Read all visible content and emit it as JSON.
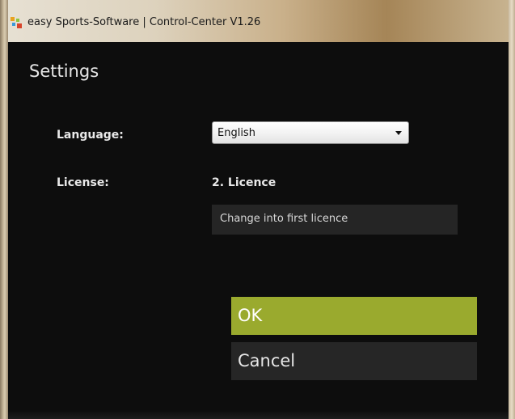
{
  "window": {
    "title": "easy Sports-Software | Control-Center V1.26",
    "icon": "app-logo-icon"
  },
  "page": {
    "title": "Settings"
  },
  "language": {
    "label": "Language:",
    "selected": "English"
  },
  "license": {
    "label": "License:",
    "value": "2. Licence",
    "change_button": "Change into first licence"
  },
  "buttons": {
    "ok": "OK",
    "cancel": "Cancel"
  },
  "colors": {
    "background": "#0d0d0d",
    "ok_accent": "#9aaa2e",
    "cancel_bg": "#262626"
  }
}
